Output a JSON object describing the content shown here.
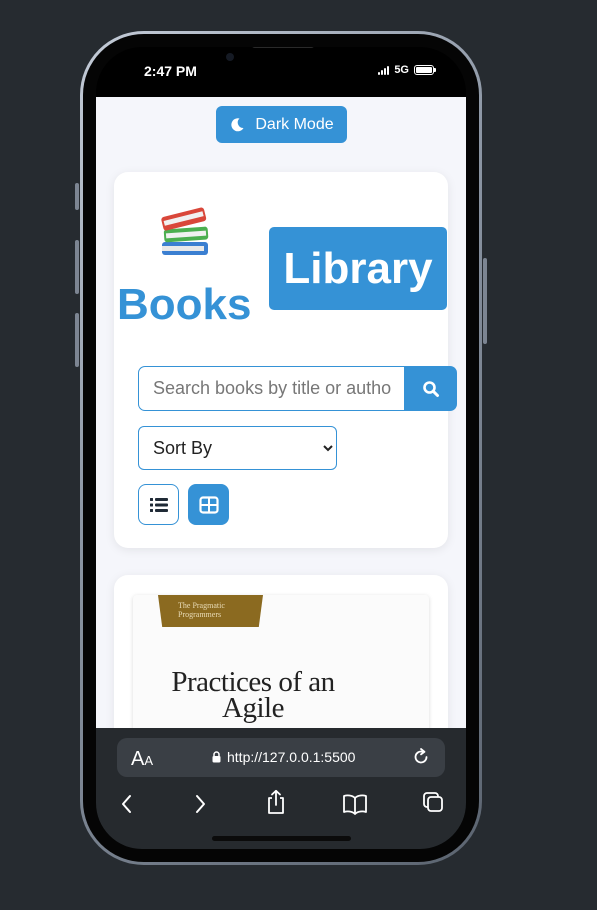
{
  "status_bar": {
    "time": "2:47 PM",
    "network": "5G"
  },
  "dark_mode_button": {
    "label": "Dark Mode"
  },
  "hero": {
    "emoji": "📚",
    "title_books": "Books",
    "title_library": "Library"
  },
  "search": {
    "placeholder": "Search books by title or author"
  },
  "sort": {
    "selected": "Sort By"
  },
  "view_toggle": {
    "list_icon": "list-icon",
    "grid_icon": "grid-icon",
    "active": "grid"
  },
  "book": {
    "publisher": "The Pragmatic Programmers",
    "title_line1": "Practices of an",
    "title_line2": "Agile"
  },
  "browser": {
    "text_size_label": "A",
    "text_size_small": "A",
    "url": "http://127.0.0.1:5500"
  },
  "colors": {
    "accent": "#3592d6",
    "page_bg": "#f5f6fb",
    "browser_bar": "#262a2e"
  }
}
